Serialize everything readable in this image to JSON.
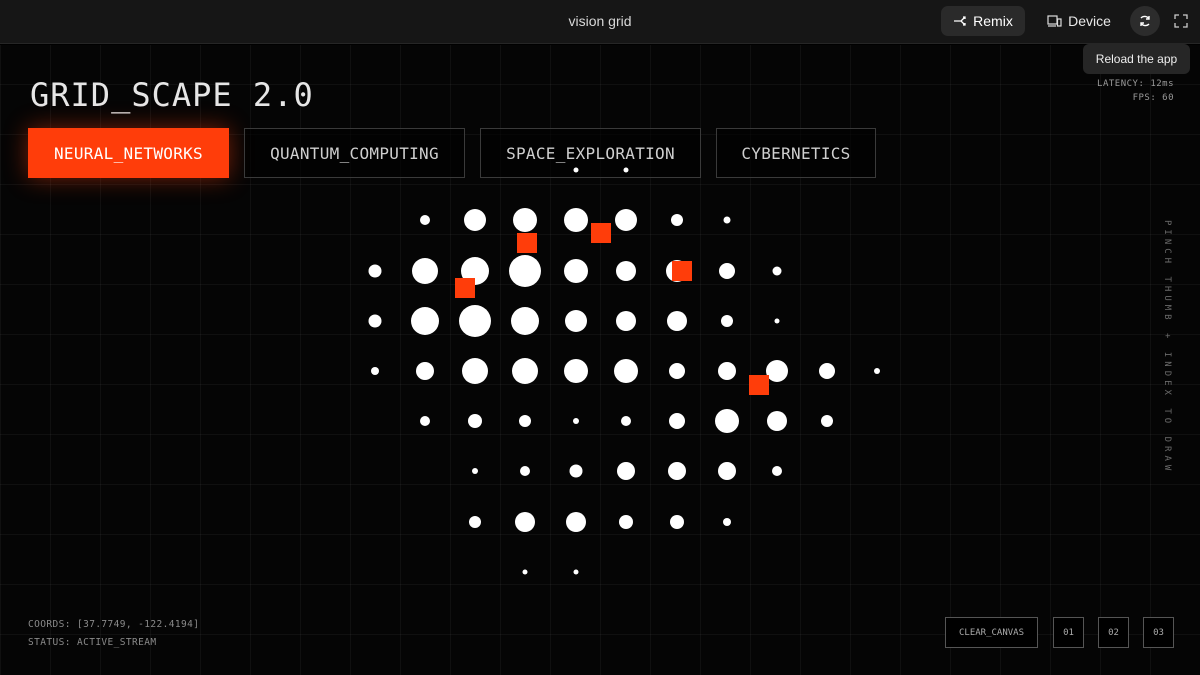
{
  "topbar": {
    "title": "vision grid",
    "remix_label": "Remix",
    "device_label": "Device",
    "tooltip": "Reload the app"
  },
  "header": {
    "title": "GRID_SCAPE 2.0",
    "latency": "LATENCY: 12ms",
    "fps": "FPS: 60"
  },
  "tabs": [
    {
      "label": "NEURAL_NETWORKS",
      "active": true
    },
    {
      "label": "QUANTUM_COMPUTING",
      "active": false
    },
    {
      "label": "SPACE_EXPLORATION",
      "active": false
    },
    {
      "label": "CYBERNETICS",
      "active": false
    }
  ],
  "hint": "PINCH THUMB + INDEX TO DRAW",
  "status": {
    "coords": "COORDS: [37.7749, -122.4194]",
    "status": "STATUS: ACTIVE_STREAM"
  },
  "controls": {
    "clear": "CLEAR_CANVAS",
    "b1": "01",
    "b2": "02",
    "b3": "03"
  },
  "colors": {
    "accent": "#ff3d0a",
    "background": "#000000",
    "dot": "#ffffff"
  }
}
